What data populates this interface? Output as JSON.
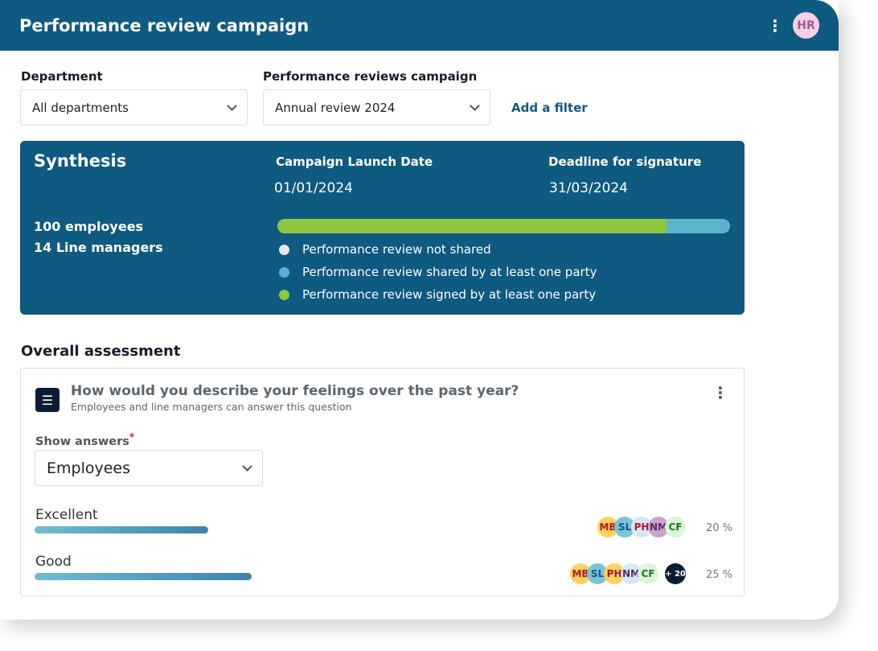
{
  "header": {
    "title": "Performance review campaign",
    "user_initials": "HR"
  },
  "filters": {
    "department": {
      "label": "Department",
      "value": "All departments"
    },
    "campaign": {
      "label": "Performance reviews campaign",
      "value": "Annual review 2024"
    },
    "add_filter": "Add a filter"
  },
  "synthesis": {
    "title": "Synthesis",
    "launch_label": "Campaign Launch Date",
    "launch_date": "01/01/2024",
    "deadline_label": "Deadline for signature",
    "deadline_date": "31/03/2024",
    "employees": "100 employees",
    "line_managers": "14 Line managers",
    "progress": {
      "signed_percent": 86,
      "shared_percent": 14,
      "not_shared_percent": 0
    },
    "legend": [
      {
        "label": "Performance review not shared",
        "color": "#e6e6e6"
      },
      {
        "label": "Performance review shared by at least one party",
        "color": "#5bb3cc"
      },
      {
        "label": "Performance review signed by at least one party",
        "color": "#8ec63f"
      }
    ]
  },
  "assessment": {
    "section_title": "Overall assessment",
    "question": "How would you describe your feelings over the past year?",
    "subtitle": "Employees and line managers can answer this question",
    "show_answers_label": "Show answers",
    "required_mark": "*",
    "show_answers_value": "Employees",
    "answers": [
      {
        "label": "Excellent",
        "percent": "20 %",
        "bar_fraction": 0.2,
        "avatars": [
          {
            "i": "MB",
            "bg": "#fdd25f",
            "fg": "#b0182a"
          },
          {
            "i": "SL",
            "bg": "#7cc3d6",
            "fg": "#0e5a80"
          },
          {
            "i": "PH",
            "bg": "#d5e7f3",
            "fg": "#b0182a"
          },
          {
            "i": "NM",
            "bg": "#c9a6cb",
            "fg": "#5a2a6a"
          },
          {
            "i": "CF",
            "bg": "#dbf5d8",
            "fg": "#1a7a1a"
          }
        ],
        "more": ""
      },
      {
        "label": "Good",
        "percent": "25 %",
        "bar_fraction": 0.25,
        "avatars": [
          {
            "i": "MB",
            "bg": "#fdd25f",
            "fg": "#b0182a"
          },
          {
            "i": "SL",
            "bg": "#7cc3d6",
            "fg": "#0e5a80"
          },
          {
            "i": "PH",
            "bg": "#fdd25f",
            "fg": "#b0182a"
          },
          {
            "i": "NM",
            "bg": "#d5e7f3",
            "fg": "#5a2a6a"
          },
          {
            "i": "CF",
            "bg": "#dbf5d8",
            "fg": "#1a7a1a"
          }
        ],
        "more": "+ 20"
      }
    ]
  }
}
